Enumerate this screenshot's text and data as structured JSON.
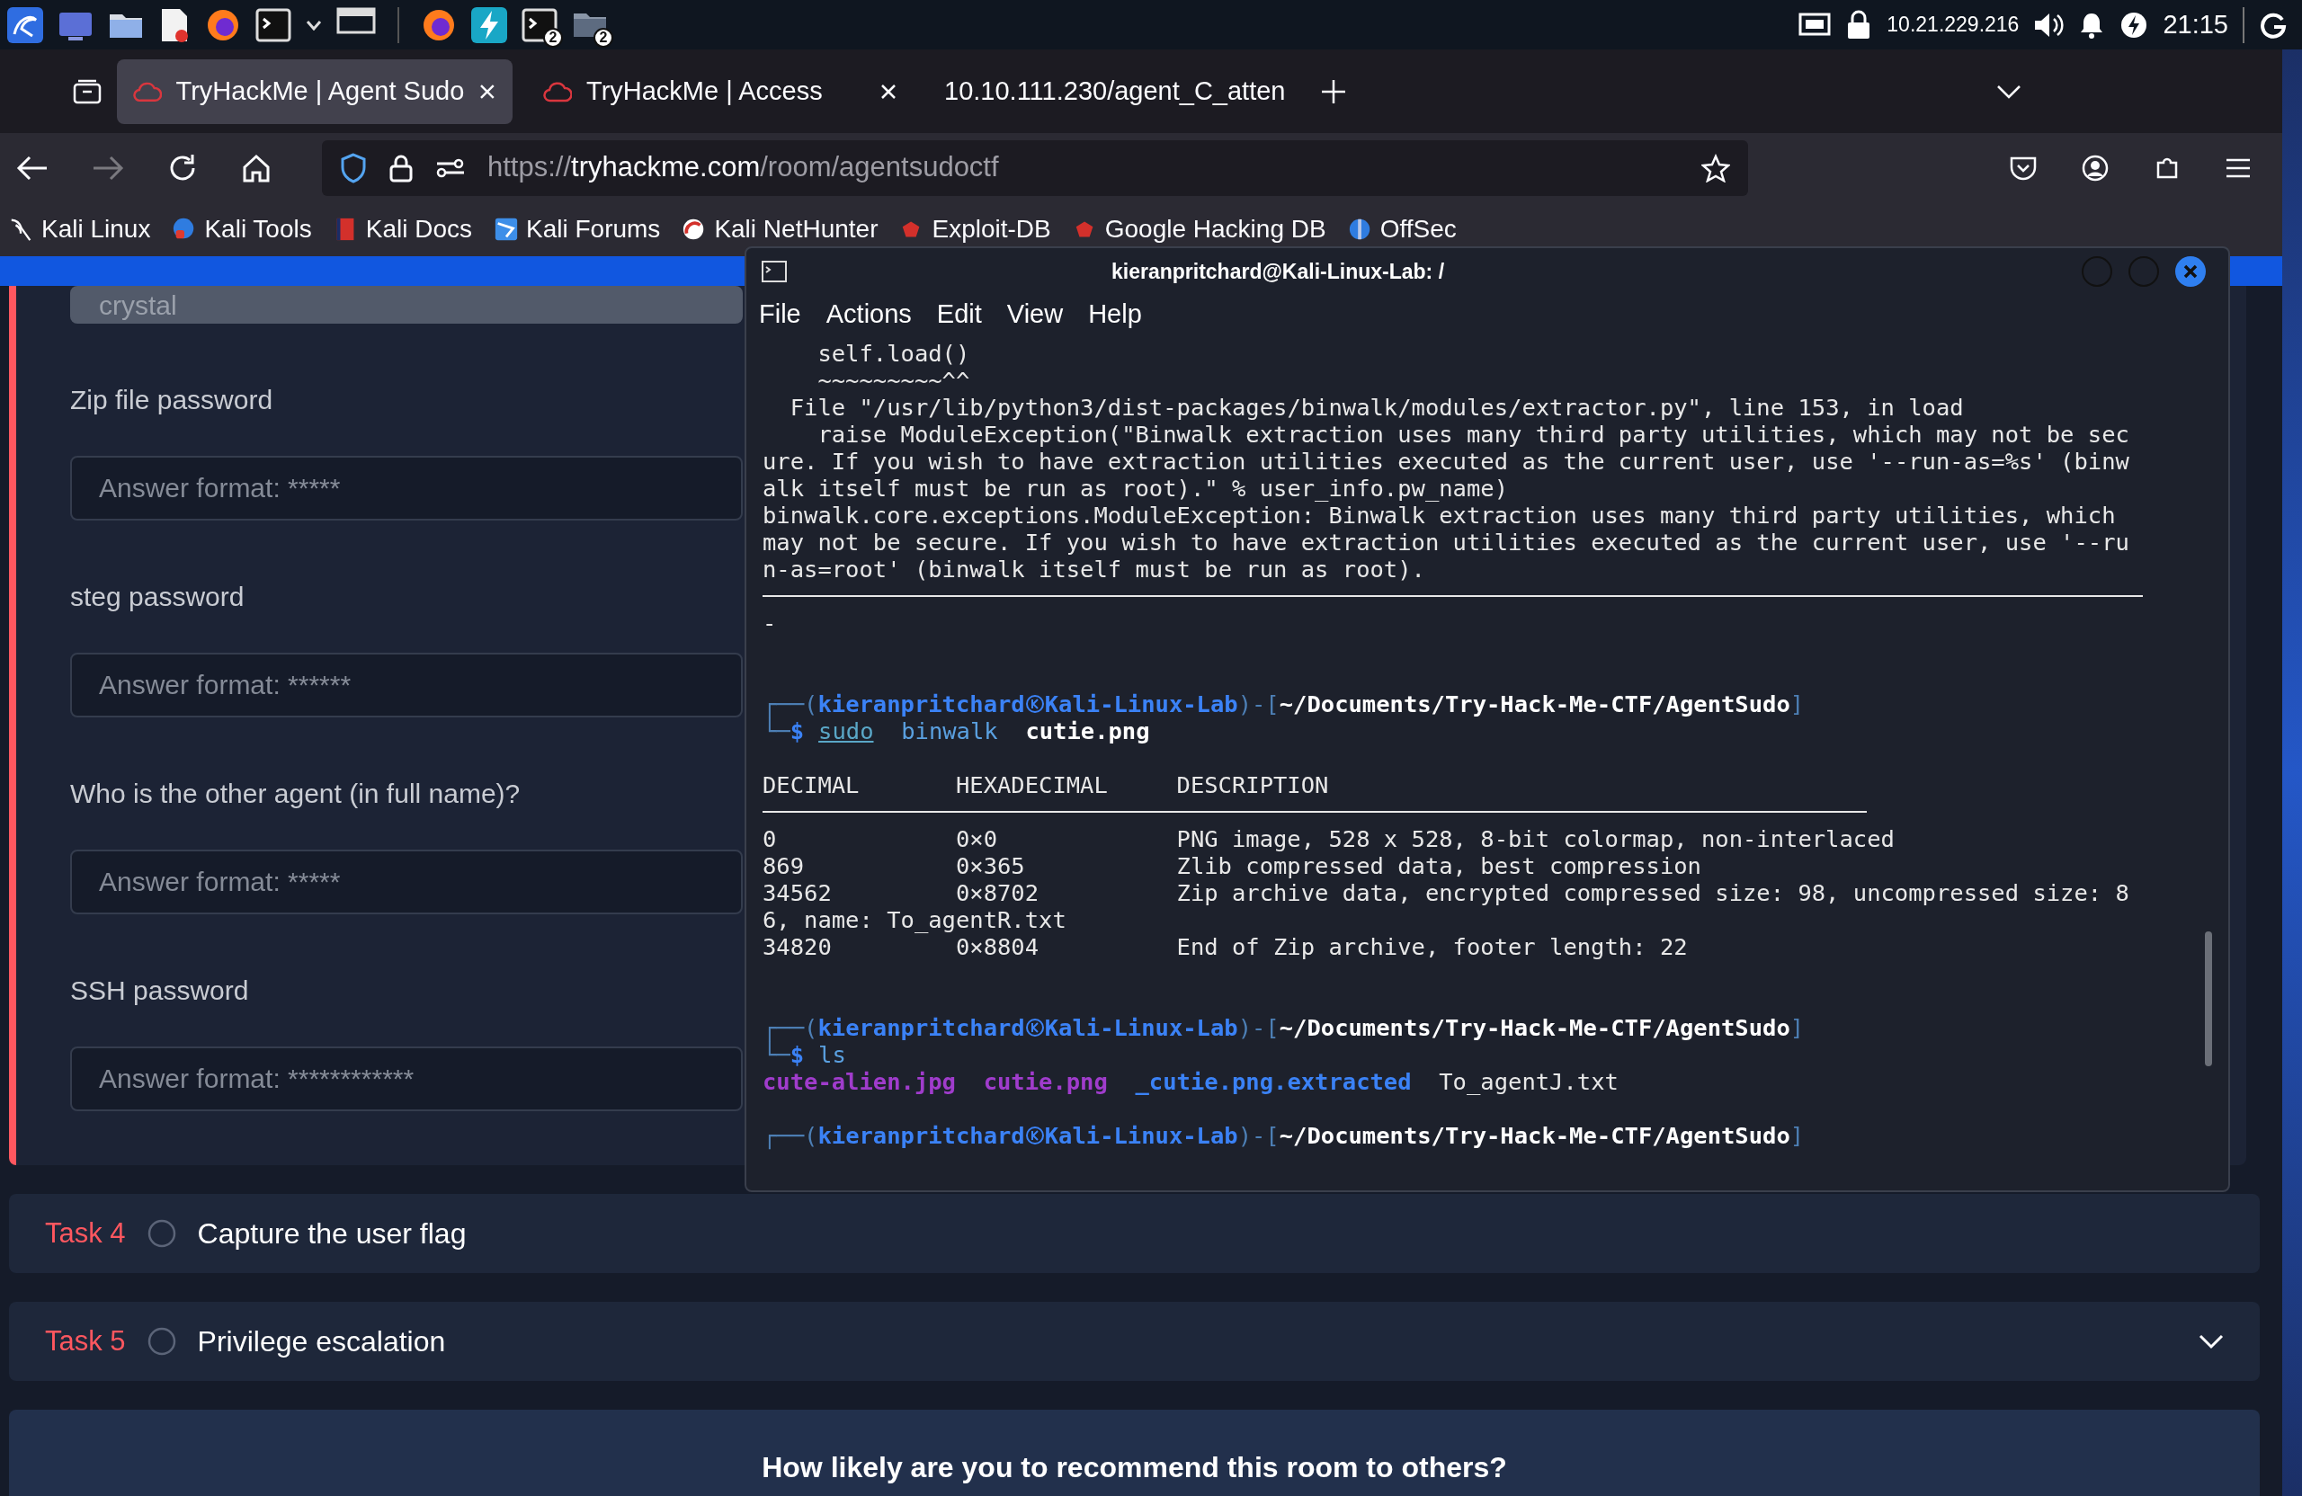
{
  "taskbar": {
    "badges": [
      "2",
      "2"
    ],
    "ip": "10.21.229.216",
    "clock": "21:15"
  },
  "browser": {
    "tabs": [
      {
        "title": "TryHackMe | Agent Sudo",
        "selected": true,
        "favicon": true
      },
      {
        "title": "TryHackMe | Access",
        "selected": false,
        "favicon": true
      },
      {
        "title": "10.10.111.230/agent_C_atten",
        "selected": false,
        "favicon": false
      }
    ],
    "forward_disabled": true,
    "url": {
      "scheme": "https://",
      "host": "tryhackme.com",
      "path": "/room/agentsudoctf"
    },
    "bookmarks": [
      "Kali Linux",
      "Kali Tools",
      "Kali Docs",
      "Kali Forums",
      "Kali NetHunter",
      "Exploit-DB",
      "Google Hacking DB",
      "OffSec"
    ]
  },
  "page": {
    "answered": {
      "value": "crystal",
      "disabled": true
    },
    "questions": [
      {
        "label": "Zip file password",
        "placeholder": "Answer format: *****"
      },
      {
        "label": "steg password",
        "placeholder": "Answer format: ******"
      },
      {
        "label": "Who is the other agent (in full name)?",
        "placeholder": "Answer format: *****"
      },
      {
        "label": "SSH password",
        "placeholder": "Answer format: ************"
      }
    ],
    "tasks": [
      {
        "number": "Task 4",
        "title": "Capture the user flag",
        "completed": false,
        "toggle_icon": false
      },
      {
        "number": "Task 5",
        "title": "Privilege escalation",
        "completed": false,
        "toggle_icon": true
      }
    ],
    "feedback": "How likely are you to recommend this room to others?"
  },
  "terminal": {
    "title": "kieranpritchard@Kali-Linux-Lab: /",
    "menu": [
      "File",
      "Actions",
      "Edit",
      "View",
      "Help"
    ],
    "lines": [
      {
        "kind": "text",
        "text": "    self.load()"
      },
      {
        "kind": "text",
        "text": "    ~~~~~~~~~^^"
      },
      {
        "kind": "text",
        "text": "  File \"/usr/lib/python3/dist-packages/binwalk/modules/extractor.py\", line 153, in load"
      },
      {
        "kind": "text",
        "text": "    raise ModuleException(\"Binwalk extraction uses many third party utilities, which may not be sec"
      },
      {
        "kind": "text",
        "text": "ure. If you wish to have extraction utilities executed as the current user, use '--run-as=%s' (binw"
      },
      {
        "kind": "text",
        "text": "alk itself must be run as root).\" % user_info.pw_name)"
      },
      {
        "kind": "text",
        "text": "binwalk.core.exceptions.ModuleException: Binwalk extraction uses many third party utilities, which"
      },
      {
        "kind": "text",
        "text": "may not be secure. If you wish to have extraction utilities executed as the current user, use '--ru"
      },
      {
        "kind": "text",
        "text": "n-as=root' (binwalk itself must be run as root)."
      },
      {
        "kind": "rule-full"
      },
      {
        "kind": "text",
        "text": "-"
      },
      {
        "kind": "blank"
      },
      {
        "kind": "blank"
      },
      {
        "kind": "prompt",
        "segments": [
          {
            "text": "┌──(",
            "kind": "frame"
          },
          {
            "text": "kieranpritchard",
            "kind": "user"
          },
          {
            "kind": "at"
          },
          {
            "text": "Kali-Linux-Lab",
            "kind": "user"
          },
          {
            "text": ")-[",
            "kind": "frame"
          },
          {
            "text": "~/Documents/Try-Hack-Me-CTF/AgentSudo",
            "kind": "path"
          },
          {
            "text": "]",
            "kind": "frame"
          }
        ]
      },
      {
        "kind": "command",
        "corner": "└─",
        "sigil": "$",
        "words": [
          {
            "text": "sudo",
            "kind": "sudo"
          },
          {
            "text": "binwalk",
            "kind": "cmd"
          },
          {
            "text": "cutie.png",
            "kind": "arg"
          }
        ]
      },
      {
        "kind": "blank"
      },
      {
        "kind": "columns",
        "cells": [
          "DECIMAL",
          "HEXADECIMAL",
          "DESCRIPTION"
        ]
      },
      {
        "kind": "rule-partial"
      },
      {
        "kind": "columns",
        "cells": [
          "0",
          "0×0",
          "PNG image, 528 x 528, 8-bit colormap, non-interlaced"
        ]
      },
      {
        "kind": "columns",
        "cells": [
          "869",
          "0×365",
          "Zlib compressed data, best compression"
        ]
      },
      {
        "kind": "columns",
        "cells": [
          "34562",
          "0×8702",
          "Zip archive data, encrypted compressed size: 98, uncompressed size: 8"
        ]
      },
      {
        "kind": "text",
        "text": "6, name: To_agentR.txt"
      },
      {
        "kind": "columns",
        "cells": [
          "34820",
          "0×8804",
          "End of Zip archive, footer length: 22"
        ]
      },
      {
        "kind": "blank"
      },
      {
        "kind": "blank"
      },
      {
        "kind": "prompt",
        "segments": [
          {
            "text": "┌──(",
            "kind": "frame"
          },
          {
            "text": "kieranpritchard",
            "kind": "user"
          },
          {
            "kind": "at"
          },
          {
            "text": "Kali-Linux-Lab",
            "kind": "user"
          },
          {
            "text": ")-[",
            "kind": "frame"
          },
          {
            "text": "~/Documents/Try-Hack-Me-CTF/AgentSudo",
            "kind": "path"
          },
          {
            "text": "]",
            "kind": "frame"
          }
        ]
      },
      {
        "kind": "command",
        "corner": "└─",
        "sigil": "$",
        "words": [
          {
            "text": "ls",
            "kind": "cmd"
          }
        ]
      },
      {
        "kind": "listing",
        "items": [
          {
            "text": "cute-alien.jpg",
            "kind": "file"
          },
          {
            "text": "cutie.png",
            "kind": "file"
          },
          {
            "text": "_cutie.png.extracted",
            "kind": "dir"
          },
          {
            "text": "To_agentJ.txt",
            "kind": "plain"
          }
        ]
      },
      {
        "kind": "blank"
      },
      {
        "kind": "prompt",
        "segments": [
          {
            "text": "┌──(",
            "kind": "frame"
          },
          {
            "text": "kieranpritchard",
            "kind": "user"
          },
          {
            "kind": "at"
          },
          {
            "text": "Kali-Linux-Lab",
            "kind": "user"
          },
          {
            "text": ")-[",
            "kind": "frame"
          },
          {
            "text": "~/Documents/Try-Hack-Me-CTF/AgentSudo",
            "kind": "path"
          },
          {
            "text": "]",
            "kind": "frame"
          }
        ]
      }
    ]
  }
}
